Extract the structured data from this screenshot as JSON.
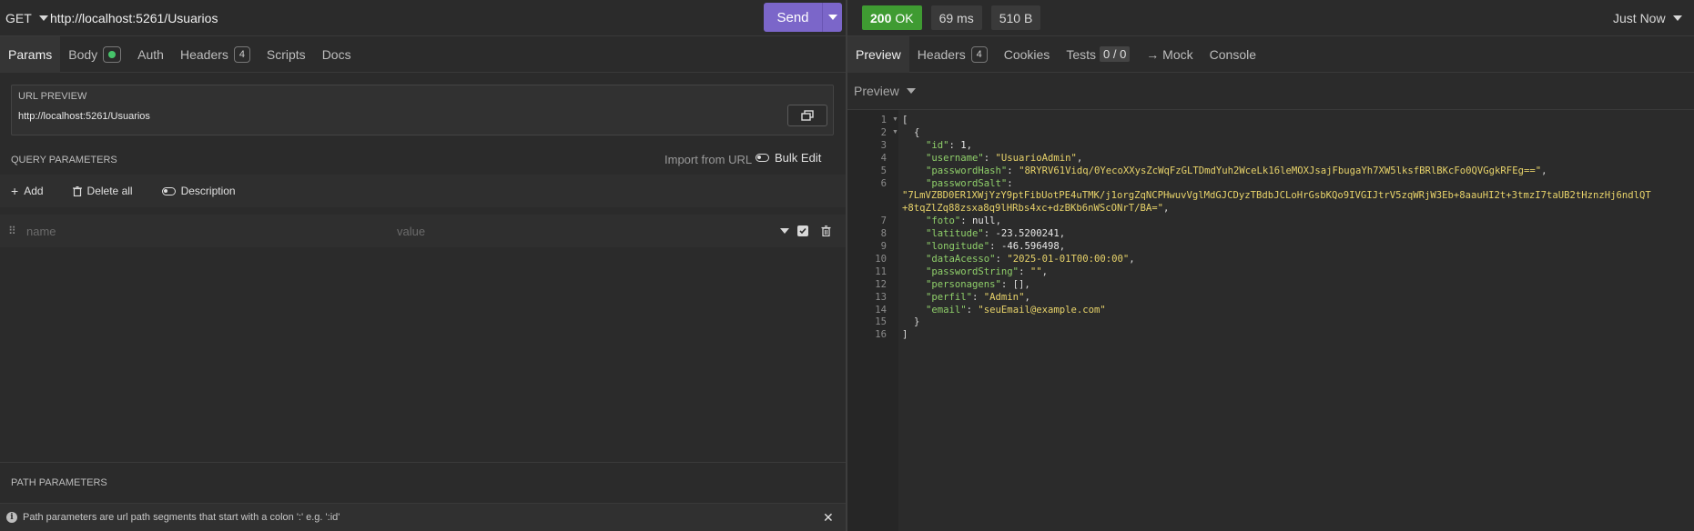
{
  "request": {
    "method": "GET",
    "url": "http://localhost:5261/Usuarios",
    "send_label": "Send"
  },
  "request_tabs": [
    {
      "label": "Params"
    },
    {
      "label": "Body"
    },
    {
      "label": "Auth"
    },
    {
      "label": "Headers",
      "badge": "4"
    },
    {
      "label": "Scripts"
    },
    {
      "label": "Docs"
    }
  ],
  "url_preview": {
    "title": "URL PREVIEW",
    "value": "http://localhost:5261/Usuarios"
  },
  "query_params": {
    "title": "QUERY PARAMETERS",
    "import_label": "Import from URL",
    "bulk_edit_label": "Bulk Edit",
    "add_label": "Add",
    "delete_all_label": "Delete all",
    "description_label": "Description",
    "name_placeholder": "name",
    "value_placeholder": "value"
  },
  "path_params": {
    "title": "PATH PARAMETERS",
    "hint": "Path parameters are url path segments that start with a colon ':' e.g. ':id'"
  },
  "response": {
    "status_code": "200",
    "status_text": "OK",
    "time": "69 ms",
    "size": "510 B",
    "timestamp": "Just Now",
    "status_color": "#3f9b32"
  },
  "response_tabs": [
    {
      "label": "Preview"
    },
    {
      "label": "Headers",
      "badge": "4"
    },
    {
      "label": "Cookies"
    },
    {
      "label": "Tests",
      "badge": "0 / 0"
    },
    {
      "label": "→ Mock"
    },
    {
      "label": "Console"
    }
  ],
  "preview_mode": "Preview",
  "json_lines": [
    {
      "n": "1",
      "fold": true,
      "indent": 0,
      "parts": [
        {
          "c": "p",
          "t": "["
        }
      ]
    },
    {
      "n": "2",
      "fold": true,
      "indent": 1,
      "parts": [
        {
          "c": "p",
          "t": "{"
        }
      ]
    },
    {
      "n": "3",
      "indent": 2,
      "parts": [
        {
          "c": "k",
          "t": "\"id\""
        },
        {
          "c": "p",
          "t": ": "
        },
        {
          "c": "n",
          "t": "1"
        },
        {
          "c": "p",
          "t": ","
        }
      ]
    },
    {
      "n": "4",
      "indent": 2,
      "parts": [
        {
          "c": "k",
          "t": "\"username\""
        },
        {
          "c": "p",
          "t": ": "
        },
        {
          "c": "s",
          "t": "\"UsuarioAdmin\""
        },
        {
          "c": "p",
          "t": ","
        }
      ]
    },
    {
      "n": "5",
      "indent": 2,
      "parts": [
        {
          "c": "k",
          "t": "\"passwordHash\""
        },
        {
          "c": "p",
          "t": ": "
        },
        {
          "c": "s",
          "t": "\"8RYRV61Vidq/0YecoXXysZcWqFzGLTDmdYuh2WceLk16leMOXJsajFbugaYh7XW5lksfBRlBKcFo0QVGgkRFEg==\""
        },
        {
          "c": "p",
          "t": ","
        }
      ]
    },
    {
      "n": "6",
      "indent": 2,
      "parts": [
        {
          "c": "k",
          "t": "\"passwordSalt\""
        },
        {
          "c": "p",
          "t": ":"
        }
      ]
    },
    {
      "n": "",
      "indent": 0,
      "parts": [
        {
          "c": "s",
          "t": "\"7LmVZBD0ER1XWjYzY9ptFibUotPE4uTMK/j1orgZqNCPHwuvVglMdGJCDyzTBdbJCLoHrGsbKQo9IVGIJtrV5zqWRjW3Eb+8aauHI2t+3tmzI7taUB2tHznzHj6ndlQT"
        }
      ]
    },
    {
      "n": "",
      "indent": 0,
      "parts": [
        {
          "c": "s",
          "t": "+8tqZlZq88zsxa8q9lHRbs4xc+dzBKb6nWScONrT/BA=\""
        },
        {
          "c": "p",
          "t": ","
        }
      ]
    },
    {
      "n": "7",
      "indent": 2,
      "parts": [
        {
          "c": "k",
          "t": "\"foto\""
        },
        {
          "c": "p",
          "t": ": "
        },
        {
          "c": "n",
          "t": "null"
        },
        {
          "c": "p",
          "t": ","
        }
      ]
    },
    {
      "n": "8",
      "indent": 2,
      "parts": [
        {
          "c": "k",
          "t": "\"latitude\""
        },
        {
          "c": "p",
          "t": ": "
        },
        {
          "c": "n",
          "t": "-23.5200241"
        },
        {
          "c": "p",
          "t": ","
        }
      ]
    },
    {
      "n": "9",
      "indent": 2,
      "parts": [
        {
          "c": "k",
          "t": "\"longitude\""
        },
        {
          "c": "p",
          "t": ": "
        },
        {
          "c": "n",
          "t": "-46.596498"
        },
        {
          "c": "p",
          "t": ","
        }
      ]
    },
    {
      "n": "10",
      "indent": 2,
      "parts": [
        {
          "c": "k",
          "t": "\"dataAcesso\""
        },
        {
          "c": "p",
          "t": ": "
        },
        {
          "c": "s",
          "t": "\"2025-01-01T00:00:00\""
        },
        {
          "c": "p",
          "t": ","
        }
      ]
    },
    {
      "n": "11",
      "indent": 2,
      "parts": [
        {
          "c": "k",
          "t": "\"passwordString\""
        },
        {
          "c": "p",
          "t": ": "
        },
        {
          "c": "s",
          "t": "\"\""
        },
        {
          "c": "p",
          "t": ","
        }
      ]
    },
    {
      "n": "12",
      "indent": 2,
      "parts": [
        {
          "c": "k",
          "t": "\"personagens\""
        },
        {
          "c": "p",
          "t": ": [],"
        }
      ]
    },
    {
      "n": "13",
      "indent": 2,
      "parts": [
        {
          "c": "k",
          "t": "\"perfil\""
        },
        {
          "c": "p",
          "t": ": "
        },
        {
          "c": "s",
          "t": "\"Admin\""
        },
        {
          "c": "p",
          "t": ","
        }
      ]
    },
    {
      "n": "14",
      "indent": 2,
      "parts": [
        {
          "c": "k",
          "t": "\"email\""
        },
        {
          "c": "p",
          "t": ": "
        },
        {
          "c": "s",
          "t": "\"seuEmail@example.com\""
        }
      ]
    },
    {
      "n": "15",
      "indent": 1,
      "parts": [
        {
          "c": "p",
          "t": "}"
        }
      ]
    },
    {
      "n": "16",
      "indent": 0,
      "parts": [
        {
          "c": "p",
          "t": "]"
        }
      ]
    }
  ]
}
